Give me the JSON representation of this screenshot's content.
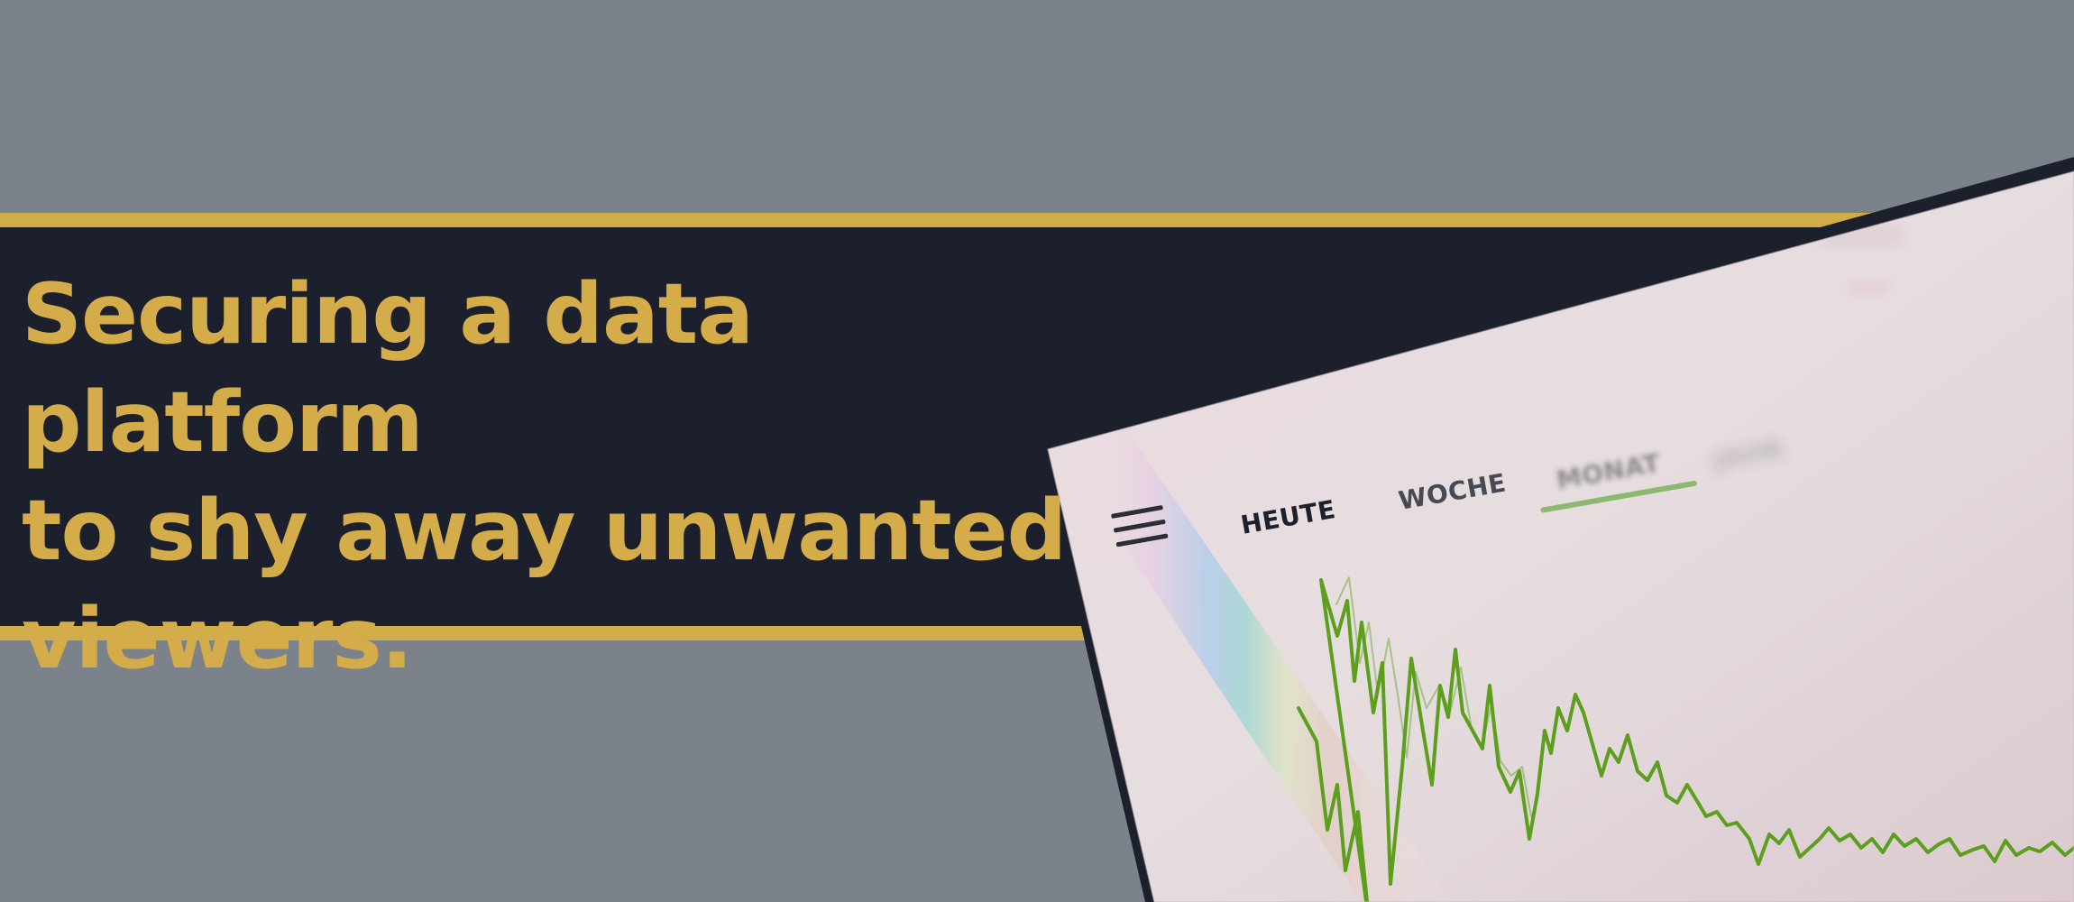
{
  "headline": {
    "text": "Securing a data platform\nto shy away unwanted\nviewers."
  },
  "screen": {
    "tabs": [
      "HEUTE",
      "WOCHE",
      "MONAT",
      "JAHR"
    ],
    "active_tab": "MONAT"
  },
  "colors": {
    "background": "#7b828a",
    "band": "#1b202c",
    "accent": "#d1ad49",
    "screen": "#e9dede",
    "line": "#5c9f1d"
  }
}
